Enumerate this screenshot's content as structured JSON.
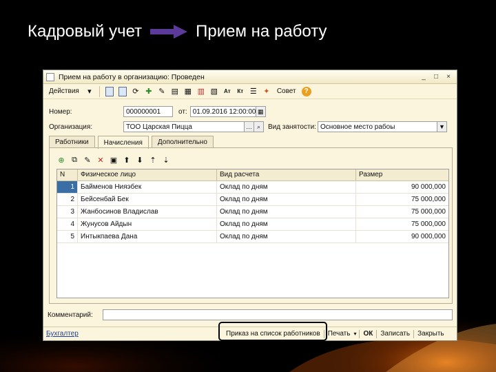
{
  "slide": {
    "title_left": "Кадровый учет",
    "title_right": "Прием на работу"
  },
  "window": {
    "title": "Прием на работу в организацию: Проведен",
    "controls": [
      "_",
      "□",
      "×"
    ]
  },
  "toolbar": {
    "actions_label": "Действия",
    "rc_label": "Ат",
    "kt_label": "Кт",
    "sovet_label": "Совет",
    "help_label": "?"
  },
  "form": {
    "nomer_label": "Номер:",
    "nomer_value": "000000001",
    "ot_label": "от:",
    "ot_value": "01.09.2016 12:00:00",
    "org_label": "Организация:",
    "org_value": "ТОО Царская Пицца",
    "vid_label": "Вид занятости:",
    "vid_value": "Основное место рабоы"
  },
  "tabs": [
    {
      "label": "Работники"
    },
    {
      "label": "Начисления"
    },
    {
      "label": "Дополнительно"
    }
  ],
  "grid": {
    "headers": [
      "N",
      "Физическое лицо",
      "Вид расчета",
      "Размер"
    ],
    "rows": [
      {
        "n": "1",
        "name": "Байменов Нияэбек",
        "calc": "Оклад по дням",
        "amount": "90 000,000"
      },
      {
        "n": "2",
        "name": "Бейсенбай Бек",
        "calc": "Оклад по дням",
        "amount": "75 000,000"
      },
      {
        "n": "3",
        "name": "Жанбосинов Владислав",
        "calc": "Оклад по дням",
        "amount": "75 000,000"
      },
      {
        "n": "4",
        "name": "Жунусов Айдын",
        "calc": "Оклад по дням",
        "amount": "75 000,000"
      },
      {
        "n": "5",
        "name": "Интыкпаева Дана",
        "calc": "Оклад по дням",
        "amount": "90 000,000"
      }
    ]
  },
  "comment": {
    "label": "Комментарий:",
    "value": ""
  },
  "bottom": {
    "responsible": "Бухгалтер",
    "prikaz": "Приказ на список работников",
    "print": "Печать",
    "ok": "ОК",
    "save": "Записать",
    "close": "Закрыть"
  },
  "colors": {
    "window_bg": "#fbf5dd",
    "selection": "#3a6ea5",
    "title_arrow": "#5b3a9a"
  }
}
